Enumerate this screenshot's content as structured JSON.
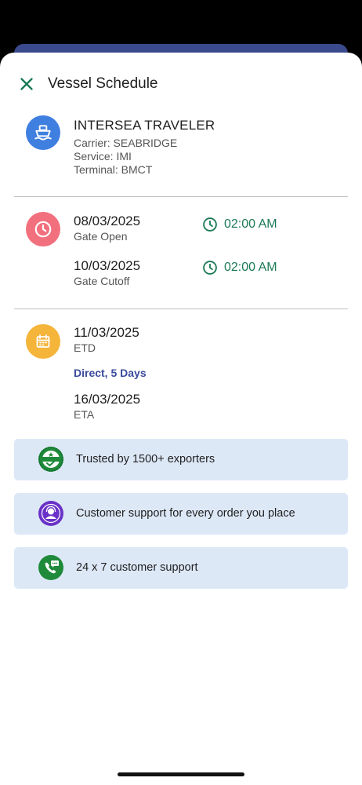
{
  "header": {
    "title": "Vessel Schedule",
    "close_icon": "close-icon",
    "accent": "#1b7a55"
  },
  "vessel": {
    "name": "INTERSEA TRAVELER",
    "carrier": "Carrier: SEABRIDGE",
    "service": "Service: IMI",
    "terminal": "Terminal: BMCT",
    "icon": "ship-icon",
    "icon_color": "#3f7fe0"
  },
  "gate": {
    "icon": "clock-icon",
    "icon_color": "#f2707e",
    "open": {
      "date": "08/03/2025",
      "label": "Gate Open",
      "time": "02:00 AM"
    },
    "cutoff": {
      "date": "10/03/2025",
      "label": "Gate Cutoff",
      "time": "02:00 AM"
    }
  },
  "voyage": {
    "icon": "calendar-icon",
    "icon_color": "#f5b43a",
    "etd": {
      "date": "11/03/2025",
      "label": "ETD"
    },
    "route": "Direct, 5 Days",
    "eta": {
      "date": "16/03/2025",
      "label": "ETA"
    }
  },
  "banners": [
    {
      "text": "Trusted by 1500+  exporters",
      "icon": "trusted-badge-icon"
    },
    {
      "text": "Customer support for every order you place",
      "icon": "support-agent-icon"
    },
    {
      "text": "24 x 7 customer support",
      "icon": "phone-chat-icon"
    }
  ]
}
